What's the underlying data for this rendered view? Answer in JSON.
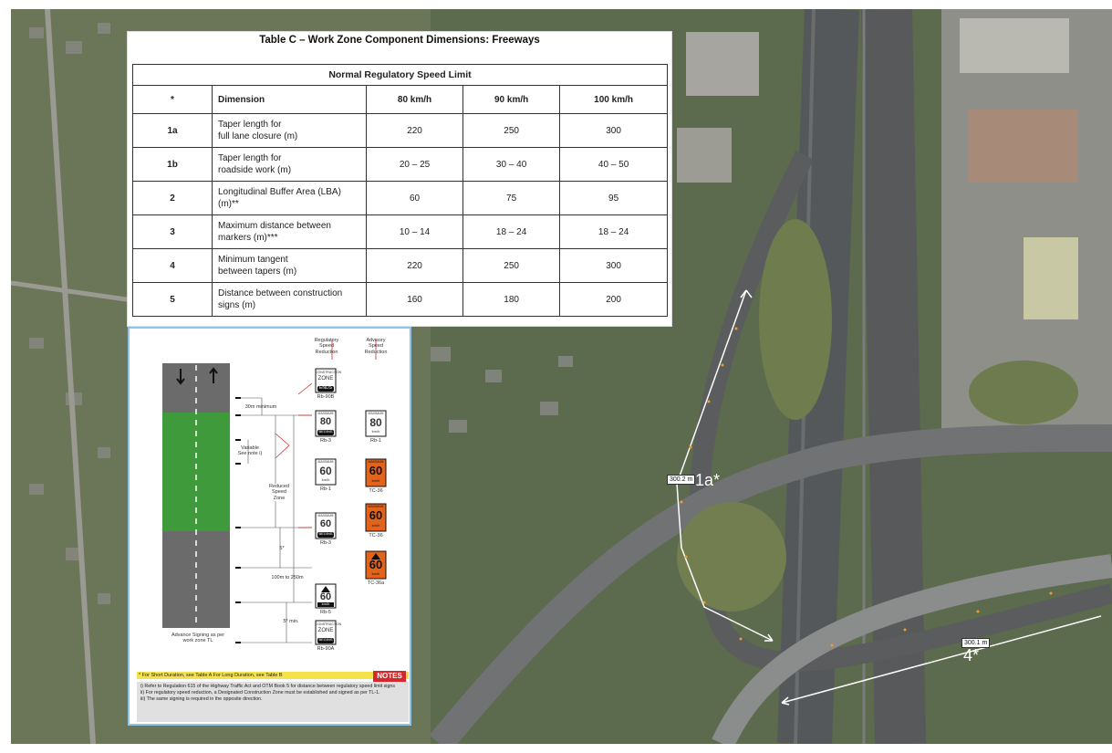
{
  "table": {
    "title": "Table C – Work Zone Component Dimensions: Freeways",
    "group_header": "Normal Regulatory Speed Limit",
    "col_headers": [
      "*",
      "Dimension",
      "80 km/h",
      "90 km/h",
      "100 km/h"
    ],
    "rows": [
      {
        "id": "1a",
        "dim_line1": "Taper length for",
        "dim_line2": "full lane closure (m)",
        "v80": "220",
        "v90": "250",
        "v100": "300"
      },
      {
        "id": "1b",
        "dim_line1": "Taper length for",
        "dim_line2": "roadside work (m)",
        "v80": "20 – 25",
        "v90": "30 – 40",
        "v100": "40 – 50"
      },
      {
        "id": "2",
        "dim_line1": "Longitudinal Buffer Area (LBA)",
        "dim_line2": "(m)**",
        "v80": "60",
        "v90": "75",
        "v100": "95"
      },
      {
        "id": "3",
        "dim_line1": "Maximum distance between",
        "dim_line2": "markers (m)***",
        "v80": "10 – 14",
        "v90": "18 – 24",
        "v100": "18 – 24"
      },
      {
        "id": "4",
        "dim_line1": "Minimum tangent",
        "dim_line2": "between tapers (m)",
        "v80": "220",
        "v90": "250",
        "v100": "300"
      },
      {
        "id": "5",
        "dim_line1": "Distance between construction",
        "dim_line2": "signs (m)",
        "v80": "160",
        "v90": "180",
        "v100": "200"
      }
    ]
  },
  "diagram": {
    "reg_header": "Regulatory Speed Reduction",
    "adv_header": "Advisory Speed Reduction",
    "label_30m": "30m minimum",
    "label_variable": "Variable See note i)",
    "label_reduced": "Reduced Speed Zone",
    "label_5a": "5*",
    "label_100_250": "100m to 250m",
    "label_5min": "5* min.",
    "label_advance": "Advance Signing as per work zone TL",
    "signs": {
      "rb90b": {
        "top": "CONSTRUCTION",
        "mid": "ZONE",
        "bot": "ENDS",
        "code": "Rb-90B"
      },
      "rb3_top": {
        "top": "MAXIMUM",
        "num": "80",
        "unit": "km/h",
        "bot": "BEGINS",
        "code": "Rb-3"
      },
      "rb1_adv": {
        "top": "MAXIMUM",
        "num": "80",
        "unit": "km/h",
        "code": "Rb-1"
      },
      "rb1": {
        "top": "MAXIMUM",
        "num": "60",
        "unit": "km/h",
        "code": "Rb-1"
      },
      "tc36_a": {
        "top": "MAXIMUM",
        "num": "60",
        "unit": "km/h",
        "code": "TC-36"
      },
      "rb3_low": {
        "top": "MAXIMUM",
        "num": "60",
        "unit": "km/h",
        "bot": "BEGINS",
        "code": "Rb-3"
      },
      "tc36_b": {
        "top": "MAXIMUM",
        "num": "60",
        "unit": "km/h",
        "code": "TC-36"
      },
      "tc36a": {
        "num": "60",
        "unit": "km/h",
        "code": "TC-36a"
      },
      "rb5": {
        "num": "60",
        "unit": "km/h",
        "code": "Rb-5"
      },
      "rb90a": {
        "top": "CONSTRUCTION",
        "mid": "ZONE",
        "bot": "BEGINS",
        "code": "Rb-90A"
      }
    },
    "notes_strip": "* For Short Duration, see Table A  For Long Duration, see Table B",
    "notes_badge": "NOTES",
    "notes": [
      "i)   Refer to Regulation 615 of the Highway Traffic Act and OTM Book 5 for distance between regulatory speed limit signs",
      "ii)  For regulatory speed reduction, a Designated Construction Zone must be established and signed as per TL-1.",
      "iii) The same signing is required in the opposite direction."
    ]
  },
  "measurements": [
    {
      "box": "300.2 m",
      "big": "1a*"
    },
    {
      "box": "300.1 m",
      "big": "4*"
    }
  ],
  "colors": {
    "sign_orange": "#e4631b",
    "work_zone_green": "#3f9a3c",
    "notes_red": "#d4292c",
    "notes_yellow": "#f4e24a"
  }
}
